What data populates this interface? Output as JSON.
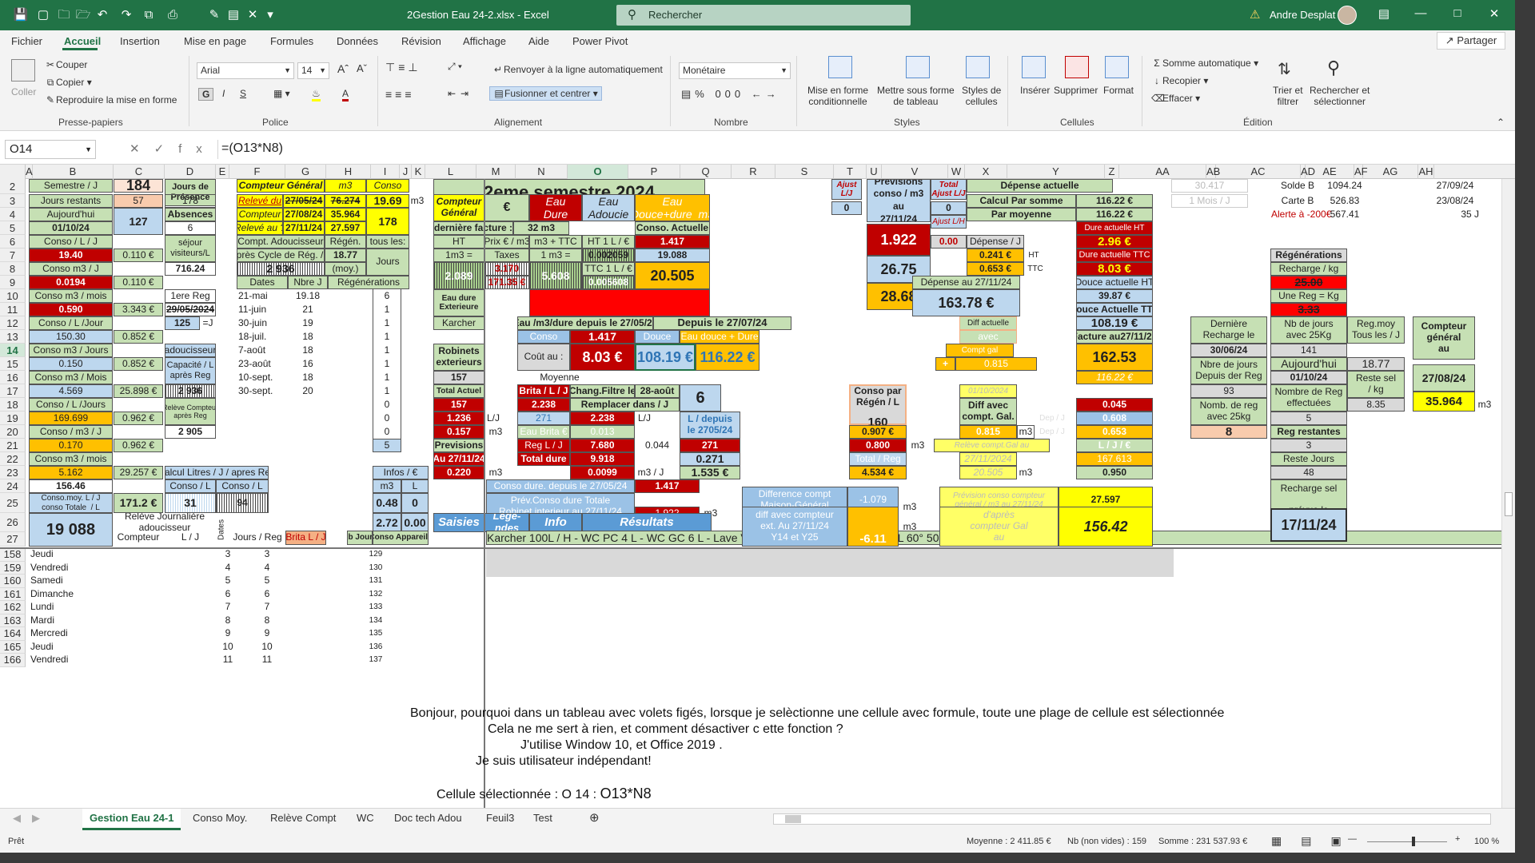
{
  "titlebar": {
    "doc_title": "2Gestion Eau 24-2.xlsx  -  Excel",
    "search_placeholder": "Rechercher",
    "user": "Andre Desplat"
  },
  "menu": [
    "Fichier",
    "Accueil",
    "Insertion",
    "Mise en page",
    "Formules",
    "Données",
    "Révision",
    "Affichage",
    "Aide",
    "Power Pivot"
  ],
  "share": "Partager",
  "ribbon": {
    "coller": "Coller",
    "couper": "Couper",
    "copier": "Copier",
    "reproduire": "Reproduire la mise en forme",
    "g_presse": "Presse-papiers",
    "font": "Arial",
    "size": "14",
    "g_police": "Police",
    "wrap": "Renvoyer à la ligne automatiquement",
    "merge": "Fusionner et centrer",
    "g_align": "Alignement",
    "numfmt": "Monétaire",
    "g_nombre": "Nombre",
    "mfc": "Mise en forme\nconditionnelle",
    "mft": "Mettre sous forme\nde tableau",
    "styles_cell": "Styles de\ncellules",
    "g_styles": "Styles",
    "inserer": "Insérer",
    "supprimer": "Supprimer",
    "format": "Format",
    "g_cellules": "Cellules",
    "somme": "Somme automatique",
    "recopier": "Recopier",
    "effacer": "Effacer",
    "trier": "Trier et\nfiltrer",
    "rechercher": "Rechercher et\nsélectionner",
    "g_edition": "Édition"
  },
  "formula_bar": {
    "namebox": "O14",
    "formula": "=(O13*N8)"
  },
  "columns": [
    "A",
    "B",
    "C",
    "D",
    "E",
    "F",
    "G",
    "H",
    "I",
    "J",
    "K",
    "L",
    "M",
    "N",
    "O",
    "P",
    "Q",
    "R",
    "S",
    "T",
    "U",
    "V",
    "W",
    "X",
    "Y",
    "Z",
    "AA",
    "AB",
    "AC",
    "AD",
    "AE",
    "AF",
    "AG",
    "AH"
  ],
  "rows_top": [
    "2",
    "3",
    "4",
    "5",
    "6",
    "7",
    "8",
    "9",
    "10",
    "11",
    "12",
    "13",
    "14",
    "15",
    "16",
    "17",
    "18",
    "19",
    "20",
    "21",
    "22",
    "23",
    "24",
    "25",
    "26",
    "27"
  ],
  "rows_bottom": [
    {
      "n": "158",
      "day": "Jeudi",
      "e": "3",
      "f": "3",
      "h": "129"
    },
    {
      "n": "159",
      "day": "Vendredi",
      "e": "4",
      "f": "4",
      "h": "130"
    },
    {
      "n": "160",
      "day": "Samedi",
      "e": "5",
      "f": "5",
      "h": "131"
    },
    {
      "n": "161",
      "day": "Dimanche",
      "e": "6",
      "f": "6",
      "h": "132"
    },
    {
      "n": "162",
      "day": "Lundi",
      "e": "7",
      "f": "7",
      "h": "133"
    },
    {
      "n": "163",
      "day": "Mardi",
      "e": "8",
      "f": "8",
      "h": "134"
    },
    {
      "n": "164",
      "day": "Mercredi",
      "e": "9",
      "f": "9",
      "h": "135"
    },
    {
      "n": "165",
      "day": "Jeudi",
      "e": "10",
      "f": "10",
      "h": "136"
    },
    {
      "n": "166",
      "day": "Vendredi",
      "e": "11",
      "f": "11",
      "h": "137"
    }
  ],
  "left": {
    "semestre": "Semestre / J",
    "semestre_v": "184",
    "jours_presence": "Jours de\nPrésence",
    "jours_restants": "Jours restants",
    "jr_v": "57",
    "jp_v": "178",
    "aujourdhui": "Aujourd'hui",
    "auj_date": "01/10/24",
    "absences": "Absences",
    "j": "J",
    "abs_v": "127",
    "six": "6",
    "sejour": "séjour\nvisiteurs/L",
    "conso_llj": "Conso / L / J",
    "v1940": "19.40",
    "v0110a": "0.110 €",
    "conso_m3j": "Conso m3 / J",
    "v71624": "716.24",
    "l": "L",
    "v00194": "0.0194",
    "v0110b": "0.110 €",
    "conso_m3mois": "Conso m3 / mois",
    "premiere_reg": "1ere Reg",
    "v0590": "0.590",
    "v3343": "3.343 €",
    "d29052024": "29/05/2024",
    "conso_lljour": "Conso / L /Jour",
    "v125": "125",
    "eqj": "=J",
    "v15030": "150.30",
    "v0852a": "0.852 €",
    "conso_m3jours": "Conso m3 / Jours",
    "adoucisseur": "adoucisseur",
    "v0150": "0.150",
    "v0852b": "0.852 €",
    "capacite": "Capacité / L\naprès Reg",
    "conso_m3Mois": "Conso m3 / Mois",
    "v2936": "2 936",
    "v4569": "4.569",
    "v25898": "25.898 €",
    "conso_ljours": "Conso / L /Jours",
    "releve_cpt": "Relève Compteur\naprès Reg",
    "v169699": "169.699",
    "v0962a": "0.962 €",
    "conso_m3j2": "Conso / m3 / J",
    "v2905": "2 905",
    "v0170": "0.170",
    "v0962b": "0.962 €",
    "conso_m3mois2": "Conso m3 / mois",
    "v5162": "5.162",
    "v29257": "29.257 €",
    "calc_litres": "Calcul Litres  / J / apres Reg",
    "v15646": "156.46",
    "l2": "L",
    "conso_l1": "Conso / L",
    "conso_l2": "Conso / L",
    "conso_moy": "Conso.moy. L / J\nconso Totale  / L",
    "v1712": "171.2 €",
    "v31": "31",
    "v94": "94",
    "v19088": "19 088",
    "releve_journaliere": "Relève Journalière\nadoucisseur",
    "compteur": "Compteur",
    "lj": "L / J",
    "dates_v": "Dates",
    "jours_reg": "Jours / Reg",
    "brita": "Brita L / J"
  },
  "compteur_general": {
    "title": "Compteur Général",
    "m3": "m3",
    "conso": "Conso",
    "releve_du": "Relevé du",
    "d270524": "27/05/24",
    "v76274": "76.274",
    "v1969": "19.69",
    "m3b": "m3",
    "compteur": "Compteur",
    "d270824": "27/08/24",
    "v35964": "35.964",
    "releve_au": "Relevé au ?",
    "d271124": "27/11/24",
    "v27597": "27.597",
    "v178": "178",
    "compt_adou": "Compt. Adoucisseur",
    "regen": "Régén.",
    "tous_les": "tous les:",
    "apres_cycle": "Après Cycle de Rég. / L",
    "v1877": "18.77",
    "jours": "Jours",
    "v2936": "2 936",
    "moy": "(moy.)",
    "dates": "Dates",
    "nbre_j": "Nbre J",
    "regenerations": "Régénérations",
    "reg_rows": [
      {
        "d": "21-mai",
        "n": "19.18",
        "r": "6"
      },
      {
        "d": "11-juin",
        "n": "21",
        "r": "1"
      },
      {
        "d": "30-juin",
        "n": "19",
        "r": "1"
      },
      {
        "d": "18-juil.",
        "n": "18",
        "r": "1"
      },
      {
        "d": "7-août",
        "n": "18",
        "r": "1"
      },
      {
        "d": "23-août",
        "n": "16",
        "r": "1"
      },
      {
        "d": "10-sept.",
        "n": "18",
        "r": "1"
      },
      {
        "d": "30-sept.",
        "n": "20",
        "r": "1"
      },
      {
        "d": "",
        "n": "",
        "r": "0"
      },
      {
        "d": "",
        "n": "",
        "r": "0"
      },
      {
        "d": "",
        "n": "",
        "r": "0"
      },
      {
        "d": "",
        "n": "",
        "r": "5"
      }
    ],
    "infos": "Infos / €",
    "m3c": "m3",
    "lc": "L",
    "v048": "0.48",
    "v0": "0",
    "v272": "2.72",
    "v000": "0.00",
    "nb_jours": "Nb Jours",
    "conso_app": "Conso Appareils"
  },
  "center": {
    "title": "2eme semestre 2024",
    "compteur_general": "Compteur\nGénéral",
    "euro": "€",
    "eau_dure": "Eau\nDure",
    "eau_adoucie": "Eau\nAdoucie",
    "eau_douce_dure": "Eau\nDouce+dure  m3",
    "derniere_facture": "dernière facture :",
    "m332": "32 m3",
    "conso_actuelle": "Conso. Actuelle",
    "ht": "HT",
    "prix": "Prix € / m3",
    "m3ttc": "m3 + TTC",
    "ht1l": "HT 1 L / €",
    "v1417": "1.417",
    "m1m3": "1m3 =",
    "taxes": "Taxes",
    "um3": "1 m3 =",
    "v0002": "0.002059",
    "v19088": "19.088",
    "v2089": "2.089",
    "v317": "3.170",
    "v171": "171.35 €",
    "v5608": "5.608",
    "ttc1l": "TTC 1 L / €",
    "v0005": "0.005608",
    "v20505": "20.505",
    "eau_dure_ext": "Eau dure\nExterieure",
    "karcher": "Karcher",
    "eau_m3": "Eau /m3/dure depuis le 27/05/24",
    "depuis": "Depuis le 27/07/24",
    "v1417b": "1.417",
    "conso": "Conso",
    "douce": "Douce",
    "eau_dd": "Eau douce + Dure",
    "robinets": "Robinets\nexterieurs",
    "cout_au": "Coût au :",
    "d011024": "01/10/24",
    "v803": "8.03 €",
    "v10819": "108.19 €",
    "v11622": "116.22 €",
    "v157": "157",
    "l": "L",
    "moyenne": "Moyenne",
    "brita_lj": "Brita / L / J",
    "chg_filtre": "Chang.Filtre le",
    "d28aout": "28-août",
    "v6": "6",
    "total_actuel": "Total Actuel",
    "v157b": "157",
    "v2238": "2.238",
    "remplacer": "Remplacer dans / J",
    "v1236": "1.236",
    "lj": "L/J",
    "v271": "271",
    "v2238b": "2.238",
    "lj2": "L/J",
    "l_depuis": "L / depuis\nle 2705/24",
    "v0157": "0.157",
    "m3": "m3",
    "eau_brita": "Eau Brita €",
    "v0013": "0.013",
    "previsions": "Previsions",
    "reg_lj": "Reg L / J",
    "v7680": "7.680",
    "v0044": "0.044",
    "v271b": "271",
    "au2711": "Au 27/11/24",
    "total_dure": "Total dure",
    "v9918": "9.918",
    "v0271": "0.271",
    "v0220": "0.220",
    "m3b": "m3",
    "v00099": "0.0099",
    "m3j": "m3 / J",
    "v1535": "1.535 €",
    "conso_dure": "Conso dure. depuis le 27/05/24",
    "v1417c": "1.417",
    "prev_conso": "Prév.Conso dure Totale\nRobinet interieur au 27/11/24",
    "v1922": "1.922",
    "m3c": "m3",
    "saisies": "Saisies",
    "legendes": "Lége-\nndes",
    "info": "Info",
    "resultats": "Résultats",
    "appliances": "Karcher 100L / H - WC PC 4 L - WC GC 6 L - Lave V 20 L - Lave L 40° 55 L - Lave L 60° 50 L - Lave L 90° 50L - Adoucisseur 160 L?"
  },
  "right": {
    "ajust": "Ajust\nL/J",
    "zero": "0",
    "prev_conso": "Previsions\nconso / m3\nau\n27/11/24",
    "v1922": "1.922",
    "total_ajust": "Total\nAjust L/J",
    "zero2": "0",
    "ajust_lh": "Ajust L/H",
    "v000": "0.00",
    "v2675": "26.75",
    "v2868": "28.68",
    "depense_actuelle": "Dépense actuelle",
    "calc_somme": "Calcul Par somme",
    "v11622": "116.22 €",
    "par_moyenne": "Par moyenne",
    "v11622b": "116.22 €",
    "depense_j": "Dépense / J",
    "dure_ht": "Dure actuelle HT",
    "v0241": "0.241 €",
    "ht": "HT",
    "v296": "2.96 €",
    "v0653": "0.653 €",
    "ttc": "TTC",
    "dure_ttc": "Dure actuelle  TTC",
    "v803": "8.03 €",
    "dep_au": "Dépense au 27/11/24",
    "douce_ht": "Douce actuelle HT",
    "v16378": "163.78 €",
    "v3987": "39.87 €",
    "douce_ttc": "Douce Actuelle TTC",
    "v10819": "108.19 €",
    "diff_actuelle": "Diff actuelle",
    "avec": "avec",
    "facture": "Facture au27/11/24",
    "compt_gal": "Compt gal",
    "v0815": "0.815",
    "plus": "+",
    "v16253": "162.53",
    "v11622c": "116.22 €",
    "d011024": "01/10/2024",
    "conso_regen": "Conso par\nRégén / L",
    "v160": "160",
    "diff_compt": "Diff avec\ncompt. Gal.",
    "v0045": "0.045",
    "v0608": "0.608",
    "v0907": "0.907 €",
    "v0815b": "0.815",
    "m3": "m3",
    "dep_j": "Dep / J",
    "v0653b": "0.653",
    "v0800": "0.800",
    "m3b": "m3",
    "releve_gal": "Relève compt.Gal au",
    "dep_j2": "Dep / J",
    "lje": "L / J / €",
    "total_reg": "Total / Reg",
    "d271124": "27/11/2024",
    "v167613": "167.613",
    "v4534": "4.534 €",
    "v20505": "20.505",
    "m3c": "m3",
    "v0950": "0.950",
    "diff_compt2": "Difference compt\nMaison-Général",
    "v1079": "-1.079",
    "m3d": "m3",
    "prev_gal": "Prévision conso compteur\ngénéral / m3 au 27/11/24",
    "v27597": "27.597",
    "diff_avec": "diff avec compteur\next. Au 27/11/24\nY14 et Y25",
    "v611": "-6.11",
    "m3e": "m3",
    "dapres": "d'après\ncompteur Gal\nau",
    "d271124b": "27/11/24",
    "v15642": "156.42"
  },
  "far": {
    "v30417": "30.417",
    "un_mois": "1 Mois / J",
    "solde_b": "Solde B",
    "v109424": "1094.24",
    "d270924": "27/09/24",
    "carte_b": "Carte B",
    "v52683": "526.83",
    "d230824": "23/08/24",
    "alerte": "Alerte à -200€",
    "v56741": "567.41",
    "j35": "35 J",
    "regenerations": "Régénérations",
    "recharge_kg": "Recharge / kg",
    "v2500": "25.00",
    "une_reg": "Une Reg = Kg",
    "v333": "3.33",
    "derniere": "Dernière\nRecharge le",
    "nbre_jours": "Nb de jours\navec 25Kg",
    "reg_moy": "Reg.moy\nTous les / J",
    "compteur_gen": "Compteur\ngénéral\nau",
    "d300624": "30/06/24",
    "v141": "141",
    "nbre_j_dep": "Nbre de jours\nDepuis der Reg",
    "aujourdhui": "Aujourd'hui",
    "d011024": "01/10/24",
    "v1877": "18.77",
    "d270824": "27/08/24",
    "v93": "93",
    "nbre_reg": "Nombre de Reg\neffectuées",
    "reste_sel": "Reste sel\n/ kg",
    "nomb_reg": "Nomb. de reg\navec 25kg",
    "v5": "5",
    "v835": "8.35",
    "v35964": "35.964",
    "m3": "m3",
    "v8": "8",
    "reg_restantes": "Reg restantes",
    "v3": "3",
    "reste_jours": "Reste Jours",
    "v48": "48",
    "recharge_sel": "Recharge sel\n\nprévue le",
    "d171124": "17/11/24"
  },
  "notes": {
    "l1": "Bonjour, pourquoi dans un tableau avec volets figés, lorsque je selèctionne une cellule avec formule, toute une plage de cellule est sélectionnée",
    "l2": "Cela ne me sert à rien, et comment désactiver c ette fonction ?",
    "l3": "J'utilise Window 10, et Office 2019 .",
    "l4": "Je suis utilisateur indépendant!",
    "l5a": "Cellule sélectionnée : O 14 : ",
    "l5b": "O13*N8"
  },
  "sheet_tabs": [
    "Gestion Eau 24-1",
    "Conso Moy.",
    "Relève Compt",
    "WC",
    "Doc tech Adou",
    "Feuil3",
    "Test"
  ],
  "status": {
    "ready": "Prêt",
    "moyenne": "Moyenne : 2 411.85 €",
    "nb": "Nb (non vides) : 159",
    "somme": "Somme : 231 537.93 €",
    "zoom": "100 %"
  }
}
